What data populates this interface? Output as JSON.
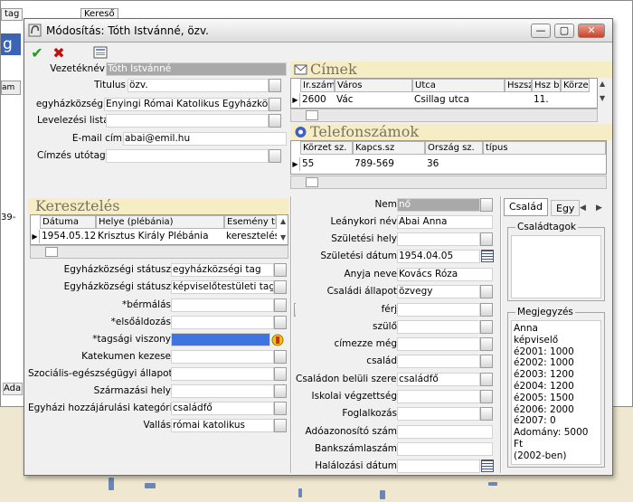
{
  "background_app": {
    "tab1": "tag",
    "tab2": "Kereső",
    "title_fragment": "g",
    "col_fragment": "am",
    "row_fragment": "39-",
    "bottom_fragment": "Ada"
  },
  "window": {
    "title": "Módosítás: Tóth Istvánné, özv.",
    "minimize": "—",
    "maximize": "▢",
    "close": "✕"
  },
  "toolbar": {
    "ok": "✔",
    "cancel": "✖"
  },
  "personal": {
    "fields": [
      {
        "label": "Vezetéknév",
        "value": "Tóth Istvánné"
      },
      {
        "label": "Titulus",
        "value": "özv."
      },
      {
        "label": "egyházközség",
        "value": "Enyingi Római Katolikus Egyházközség"
      },
      {
        "label": "Levelezési lista",
        "value": ""
      },
      {
        "label": "E-mail cím",
        "value": "abai@emil.hu"
      },
      {
        "label": "Címzés utótag",
        "value": ""
      }
    ]
  },
  "cimek": {
    "title": "Címek",
    "columns": [
      "Ir.szám",
      "Város",
      "Utca",
      "Hszsz",
      "Hsz b",
      "Körzet"
    ],
    "rows": [
      [
        "2600",
        "Vác",
        "Csillag utca",
        "",
        "11.",
        ""
      ]
    ]
  },
  "telefonszamok": {
    "title": "Telefonszámok",
    "columns": [
      "Körzet sz.",
      "Kapcs.sz",
      "Ország sz.",
      "típus"
    ],
    "rows": [
      [
        "55",
        "789-569",
        "36",
        ""
      ]
    ]
  },
  "keresztel": {
    "title": "Keresztelés",
    "columns": [
      "Dátuma",
      "Helye (plébánia)",
      "Esemény típ"
    ],
    "rows": [
      [
        "1954.05.12",
        "Krisztus Király Plébánia",
        "keresztelés"
      ]
    ]
  },
  "church_fields": [
    {
      "label": "Egyházközségi státusz",
      "value": "egyházközségi tag"
    },
    {
      "label": "Egyházközségi státusz",
      "value": "képviselőtestületi tag"
    },
    {
      "label": "*bérmálás",
      "value": ""
    },
    {
      "label": "*elsőáldozás",
      "value": ""
    },
    {
      "label": "*tagsági viszony",
      "value": ""
    },
    {
      "label": "Katekumen kezese",
      "value": ""
    },
    {
      "label": "Szociális-egészségügyi állapot",
      "value": ""
    },
    {
      "label": "Származási hely",
      "value": ""
    },
    {
      "label": "Egyházi hozzájárulási kategória",
      "value": "családfő"
    },
    {
      "label": "Vallás",
      "value": "római katolikus"
    }
  ],
  "mid_fields": [
    {
      "label": "Nem",
      "value": "nő"
    },
    {
      "label": "Leánykori név",
      "value": "Abai Anna"
    },
    {
      "label": "Születési hely",
      "value": ""
    },
    {
      "label": "Születési dátum",
      "value": "1954.04.05"
    },
    {
      "label": "Anyja neve",
      "value": "Kovács Róza"
    },
    {
      "label": "Családi állapot",
      "value": "özvegy"
    },
    {
      "label": "férj",
      "value": ""
    },
    {
      "label": "szülő",
      "value": ""
    },
    {
      "label": "címezze még",
      "value": ""
    },
    {
      "label": "család",
      "value": ""
    },
    {
      "label": "Családon belüli szerep",
      "value": "családfő"
    },
    {
      "label": "Iskolai végzettség",
      "value": ""
    },
    {
      "label": "Foglalkozás",
      "value": ""
    },
    {
      "label": "Adóazonosító szám",
      "value": ""
    },
    {
      "label": "Bankszámlaszám",
      "value": ""
    },
    {
      "label": "Halálozási dátum",
      "value": ""
    }
  ],
  "tabs": {
    "tab1": "Család",
    "tab2": "Egy"
  },
  "csaladtagok": {
    "label": "Családtagok"
  },
  "megjegyzes": {
    "label": "Megjegyzés",
    "lines": [
      "Anna",
      "képviselő",
      "é2001: 1000",
      "é2002: 1000",
      "é2003: 1200",
      "é2004: 1200",
      "é2005: 1500",
      "é2006: 2000",
      "é2007: 0",
      "Adomány: 5000 Ft",
      "(2002-ben)"
    ]
  },
  "colors": {
    "header_bg": "#f6edc4",
    "selected": "#3d74e0",
    "gray_field": "#a9a9a9"
  }
}
